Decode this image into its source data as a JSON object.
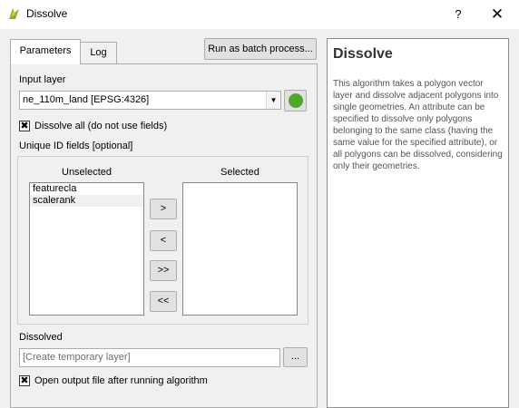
{
  "window": {
    "title": "Dissolve",
    "help_label": "?",
    "close_label": "✕"
  },
  "tabs": [
    {
      "label": "Parameters",
      "active": true
    },
    {
      "label": "Log",
      "active": false
    }
  ],
  "batch_button": "Run as batch process...",
  "params": {
    "input_layer_label": "Input layer",
    "input_layer_value": "ne_110m_land [EPSG:4326]",
    "dissolve_all_label": "Dissolve all (do not use fields)",
    "dissolve_all_checked": true,
    "unique_id_label": "Unique ID fields [optional]",
    "unselected_header": "Unselected",
    "selected_header": "Selected",
    "unselected_items": [
      "featurecla",
      "scalerank"
    ],
    "selected_items": [],
    "move_buttons": [
      ">",
      "<",
      ">>",
      "<<"
    ],
    "dissolved_label": "Dissolved",
    "dissolved_placeholder": "[Create temporary layer]",
    "browse_label": "...",
    "open_output_label": "Open output file after running algorithm",
    "open_output_checked": true
  },
  "help": {
    "title": "Dissolve",
    "text": "This algorithm takes a polygon vector layer and dissolve adjacent polygons into single geometries. An attribute can be specified to dissolve only polygons belonging to the same class (having the same value for the specified attribute), or all polygons can be dissolved, considering only their geometries."
  },
  "colors": {
    "accent_green": "#4ea82c"
  }
}
